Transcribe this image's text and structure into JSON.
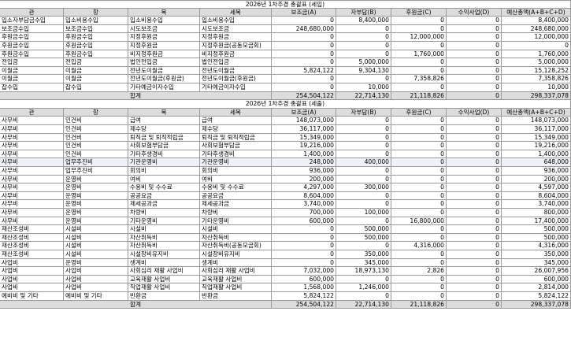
{
  "table1": {
    "title": "2026년 1차추경 총괄표 (세입)",
    "headers": [
      "관",
      "항",
      "목",
      "세목",
      "보조금(A)",
      "자부담(B)",
      "후원금(C)",
      "수익사업(D)",
      "예산총액(A+B+C+D)"
    ],
    "rows": [
      [
        "입소자부담금수입",
        "입소비용수입",
        "입소비용수입",
        "입소비용수입",
        "0",
        "8,400,000",
        "0",
        "0",
        "8,400,000"
      ],
      [
        "보조금수입",
        "보조금수입",
        "시도보조금",
        "시도보조금",
        "248,680,000",
        "0",
        "0",
        "0",
        "248,680,000"
      ],
      [
        "후원금수입",
        "후원금수입",
        "지정후원금",
        "지정후원금",
        "0",
        "0",
        "12,000,000",
        "0",
        "12,000,000"
      ],
      [
        "후원금수입",
        "후원금수입",
        "지정후원금",
        "지정후원금(공동모금회)",
        "0",
        "0",
        "0",
        "0",
        "0"
      ],
      [
        "후원금수입",
        "후원금수입",
        "비지정후원금",
        "비지정후원금",
        "0",
        "0",
        "1,760,000",
        "0",
        "1,760,000"
      ],
      [
        "전입금",
        "전입금",
        "법인전입금",
        "법인전입금",
        "0",
        "5,000,000",
        "0",
        "0",
        "5,000,000"
      ],
      [
        "이월금",
        "이월금",
        "전년도이월금",
        "전년도이월금",
        "5,824,122",
        "9,304,130",
        "0",
        "0",
        "15,128,252"
      ],
      [
        "이월금",
        "이월금",
        "전년도이월금(후원금)",
        "전년도이월금(후원금)",
        "0",
        "0",
        "7,358,826",
        "0",
        "7,358,826"
      ],
      [
        "잡수입",
        "잡수입",
        "기타예금이자수입",
        "기타예금이자수입",
        "0",
        "10,000",
        "0",
        "0",
        "10,000"
      ]
    ],
    "total": {
      "label": "합계",
      "values": [
        "254,504,122",
        "22,714,130",
        "21,118,826",
        "0",
        "298,337,078"
      ]
    }
  },
  "table2": {
    "title": "2026년 1차추경 총괄표 (세출)",
    "headers": [
      "관",
      "항",
      "목",
      "세목",
      "보조금(A)",
      "자부담(B)",
      "후원금(C)",
      "수익사업(D)",
      "예산총액(A+B+C+D)"
    ],
    "rows": [
      [
        "사무비",
        "인건비",
        "급여",
        "급여",
        "148,073,000",
        "0",
        "0",
        "0",
        "148,073,000"
      ],
      [
        "사무비",
        "인건비",
        "제수당",
        "제수당",
        "36,117,000",
        "0",
        "0",
        "0",
        "36,117,000"
      ],
      [
        "사무비",
        "인건비",
        "퇴직금 및 퇴직적립금",
        "퇴직금 및 퇴직적립금",
        "15,349,000",
        "0",
        "0",
        "0",
        "15,349,000"
      ],
      [
        "사무비",
        "인건비",
        "사회보험부담금",
        "사회보험부담금",
        "19,216,000",
        "0",
        "0",
        "0",
        "19,216,000"
      ],
      [
        "사무비",
        "인건비",
        "기타후생경비",
        "기타후생경비",
        "1,400,000",
        "0",
        "0",
        "0",
        "1,400,000"
      ],
      [
        "사무비",
        "업무추진비",
        "기관운영비",
        "기관운영비",
        "248,000",
        "400,000",
        "0",
        "0",
        "648,000"
      ],
      [
        "사무비",
        "업무추진비",
        "회의비",
        "회의비",
        "936,000",
        "0",
        "0",
        "0",
        "936,000"
      ],
      [
        "사무비",
        "운영비",
        "여비",
        "여비",
        "200,000",
        "0",
        "0",
        "0",
        "200,000"
      ],
      [
        "사무비",
        "운영비",
        "수용비 및 수수료",
        "수용비 및 수수료",
        "4,297,000",
        "300,000",
        "0",
        "0",
        "4,597,000"
      ],
      [
        "사무비",
        "운영비",
        "공공요금",
        "공공요금",
        "8,604,000",
        "0",
        "0",
        "0",
        "8,604,000"
      ],
      [
        "사무비",
        "운영비",
        "제세공과금",
        "제세공과금",
        "3,740,000",
        "0",
        "0",
        "0",
        "3,740,000"
      ],
      [
        "사무비",
        "운영비",
        "차량비",
        "차량비",
        "700,000",
        "100,000",
        "0",
        "0",
        "800,000"
      ],
      [
        "사무비",
        "운영비",
        "기타운영비",
        "기타운영비",
        "600,000",
        "0",
        "16,800,000",
        "0",
        "17,400,000"
      ],
      [
        "재산조성비",
        "시설비",
        "시설비",
        "시설비",
        "0",
        "500,000",
        "0",
        "0",
        "500,000"
      ],
      [
        "재산조성비",
        "시설비",
        "자산취득비",
        "자산취득비",
        "0",
        "500,000",
        "0",
        "0",
        "500,000"
      ],
      [
        "재산조성비",
        "시설비",
        "자산취득비",
        "자산취득비(공동모금회)",
        "0",
        "0",
        "4,316,000",
        "0",
        "4,316,000"
      ],
      [
        "재산조성비",
        "시설비",
        "시설장비유지비",
        "시설장비유지비",
        "0",
        "350,000",
        "0",
        "0",
        "350,000"
      ],
      [
        "사업비",
        "운영비",
        "생계비",
        "생계비",
        "0",
        "345,000",
        "0",
        "0",
        "345,000"
      ],
      [
        "사업비",
        "사업비",
        "사회심리 재활 사업비",
        "사회심리 재활 사업비",
        "7,032,000",
        "18,973,130",
        "2,826",
        "0",
        "26,007,956"
      ],
      [
        "사업비",
        "사업비",
        "교육재활 사업비",
        "교육재활 사업비",
        "600,000",
        "0",
        "0",
        "0",
        "600,000"
      ],
      [
        "사업비",
        "사업비",
        "직업재활 사업비",
        "직업재활 사업비",
        "1,568,000",
        "1,246,000",
        "0",
        "0",
        "2,814,000"
      ],
      [
        "예비비 및 기타",
        "예비비 및 기타",
        "반환금",
        "반환금",
        "5,824,122",
        "0",
        "0",
        "0",
        "5,824,122"
      ]
    ],
    "total": {
      "label": "합계",
      "values": [
        "254,504,122",
        "22,714,130",
        "21,118,826",
        "0",
        "298,337,078"
      ]
    }
  }
}
